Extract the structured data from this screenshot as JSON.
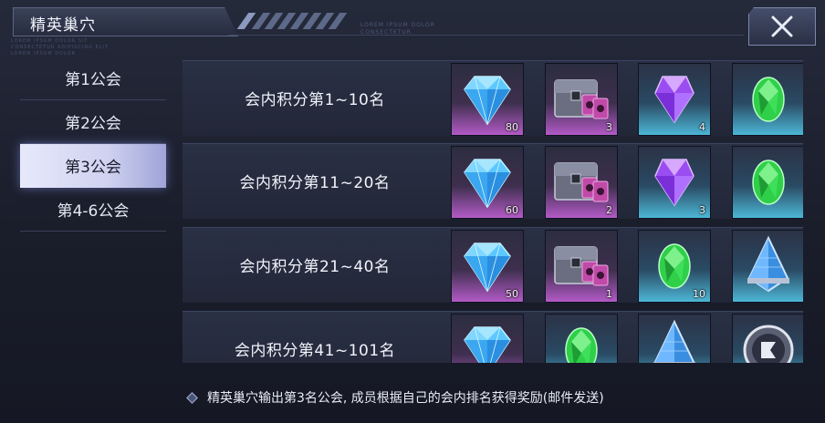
{
  "window": {
    "title": "精英巢穴"
  },
  "decor": {
    "lorem_top": [
      "LOREM IPSUM DOLOR",
      "CONSECTETUR"
    ],
    "lorem_left": [
      "LOREM IPSUM DOLOR SIT",
      "CONSECTETUR ADIPISCING ELIT",
      "LOREM IPSUM DOLOR"
    ]
  },
  "sidebar": {
    "items": [
      {
        "label": "第1公会",
        "active": false
      },
      {
        "label": "第2公会",
        "active": false
      },
      {
        "label": "第3公会",
        "active": true
      },
      {
        "label": "第4-6公会",
        "active": false
      }
    ]
  },
  "rewards": [
    {
      "label": "会内积分第1~10名",
      "items": [
        {
          "icon": "blue-diamond-icon",
          "frame": "pink",
          "qty": "80"
        },
        {
          "icon": "treasure-chest-icon",
          "frame": "pink",
          "qty": "3"
        },
        {
          "icon": "purple-gem-icon",
          "frame": "blue",
          "qty": "4"
        },
        {
          "icon": "green-gem-icon",
          "frame": "blue",
          "qty": ""
        }
      ]
    },
    {
      "label": "会内积分第11~20名",
      "items": [
        {
          "icon": "blue-diamond-icon",
          "frame": "pink",
          "qty": "60"
        },
        {
          "icon": "treasure-chest-icon",
          "frame": "pink",
          "qty": "2"
        },
        {
          "icon": "purple-gem-icon",
          "frame": "blue",
          "qty": "3"
        },
        {
          "icon": "green-gem-icon",
          "frame": "blue",
          "qty": ""
        }
      ]
    },
    {
      "label": "会内积分第21~40名",
      "items": [
        {
          "icon": "blue-diamond-icon",
          "frame": "pink",
          "qty": "50"
        },
        {
          "icon": "treasure-chest-icon",
          "frame": "pink",
          "qty": "1"
        },
        {
          "icon": "green-gem-icon",
          "frame": "blue",
          "qty": "10"
        },
        {
          "icon": "blue-crystal-icon",
          "frame": "blue",
          "qty": ""
        }
      ]
    },
    {
      "label": "会内积分第41~101名",
      "items": [
        {
          "icon": "blue-diamond-icon",
          "frame": "pink",
          "qty": ""
        },
        {
          "icon": "green-gem-icon",
          "frame": "blue",
          "qty": ""
        },
        {
          "icon": "blue-crystal-icon",
          "frame": "blue",
          "qty": ""
        },
        {
          "icon": "silver-badge-icon",
          "frame": "blue",
          "qty": ""
        }
      ]
    }
  ],
  "footer": {
    "text": "精英巢穴输出第3名公会, 成员根据自己的会内排名获得奖励(邮件发送)"
  },
  "colors": {
    "active_tab": "#d6d8f3",
    "pink_frame": "#b35ac6",
    "blue_frame": "#4cb7d6"
  }
}
